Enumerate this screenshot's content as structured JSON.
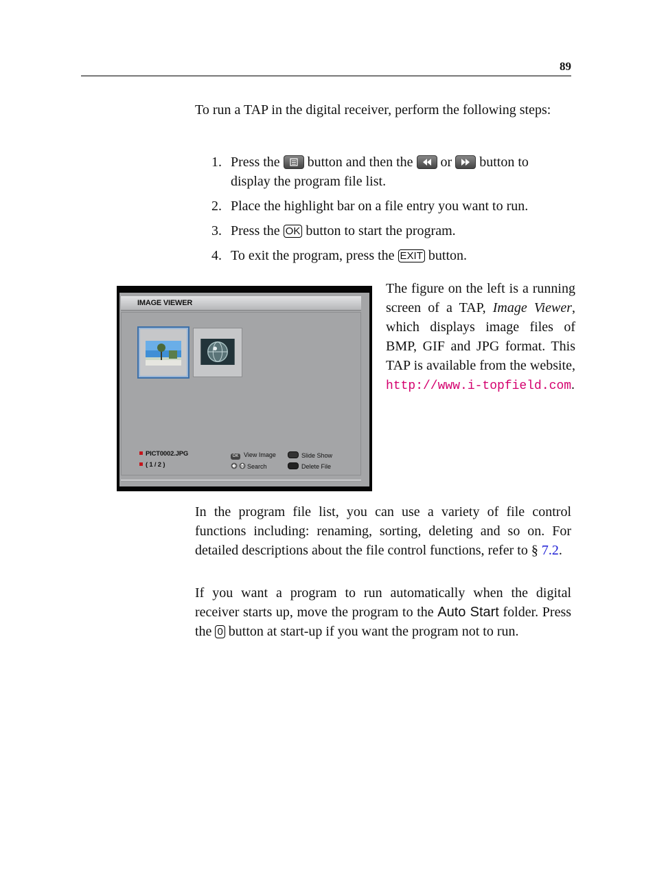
{
  "header": {
    "page_number": "89"
  },
  "intro": "To run a TAP in the digital receiver, perform the following steps:",
  "steps": [
    {
      "num": "1.",
      "parts": {
        "a": "Press the",
        "b": "button and then the",
        "c": "or",
        "d": "button to display the program file list."
      },
      "icons": [
        "list-button-icon",
        "rewind-button-icon",
        "fast-forward-button-icon"
      ]
    },
    {
      "num": "2.",
      "text": "Place the highlight bar on a file entry you want to run."
    },
    {
      "num": "3.",
      "parts": {
        "a": "Press the",
        "key": "OK",
        "b": "button to start the program."
      }
    },
    {
      "num": "4.",
      "parts": {
        "a": "To exit the program, press the",
        "key": "EXIT",
        "b": "button."
      }
    }
  ],
  "figure": {
    "title": "IMAGE VIEWER",
    "thumbnails": [
      {
        "label": "palm-tree-photo",
        "selected": true
      },
      {
        "label": "globe-photo",
        "selected": false
      }
    ],
    "file_name": "PICT0002.JPG",
    "page_indicator": "( 1 / 2 )",
    "controls": {
      "ok_badge": "OK",
      "view_image": "View Image",
      "search": "Search",
      "slide_show": "Slide Show",
      "delete_file": "Delete File"
    },
    "colors": {
      "selected_border": "#3c6fa8",
      "marker_red": "#c4161c",
      "screen_gray": "#a4a5a7"
    }
  },
  "figure_caption": {
    "text_a": "The figure on the left is a running screen of a TAP,",
    "italic": "Image Viewer",
    "text_b": ", which displays image files of BMP, GIF and JPG format.  This TAP is available from the website,",
    "link": "http://www.i-topfield.com",
    "text_c": "."
  },
  "para1": {
    "text": "In the program file list, you can use a variety of file control functions including: renaming, sorting, deleting and so on. For detailed descriptions about the file control functions, refer to",
    "section_symbol": "§",
    "xref": "7.2",
    "end": "."
  },
  "para2": {
    "a": "If you want a program to run automatically when the digital receiver starts up, move the program to the",
    "folder": "Auto Start",
    "b": "folder. Press the",
    "key": "0",
    "c": "button at start-up if you want the program not to run."
  },
  "colors": {
    "link": "#d4006e",
    "xref": "#1a1ad4"
  }
}
